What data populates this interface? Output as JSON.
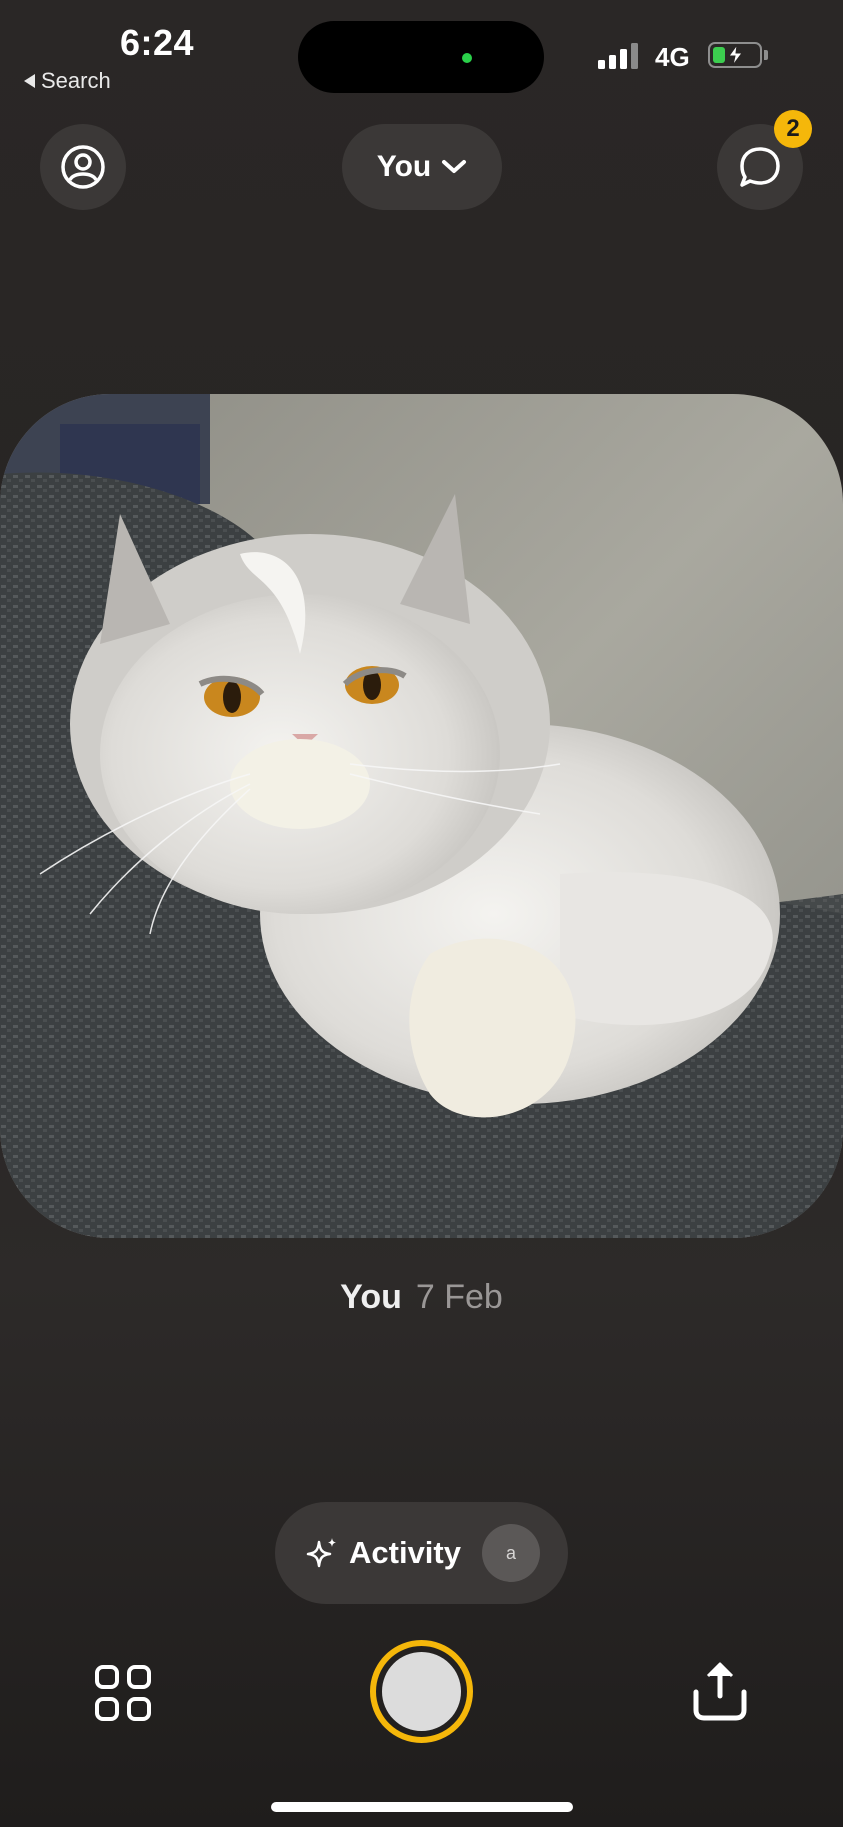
{
  "status_bar": {
    "time": "6:24",
    "back_label": "Search",
    "network": "4G",
    "battery_color": "#3ccd4f"
  },
  "header": {
    "profile_icon": "person-circle-icon",
    "audience_label": "You",
    "audience_icon": "chevron-down-icon",
    "chat_icon": "chat-bubble-icon",
    "chat_badge_count": "2",
    "badge_color": "#f5b70a"
  },
  "post": {
    "image_description_icon": "photo-cat",
    "author": "You",
    "date": "7 Feb"
  },
  "activity": {
    "icon": "sparkles-icon",
    "label": "Activity",
    "avatar_initial": "a"
  },
  "bottom_bar": {
    "grid_icon": "grid-icon",
    "shutter_color": "#f5b70a",
    "share_icon": "share-icon"
  }
}
